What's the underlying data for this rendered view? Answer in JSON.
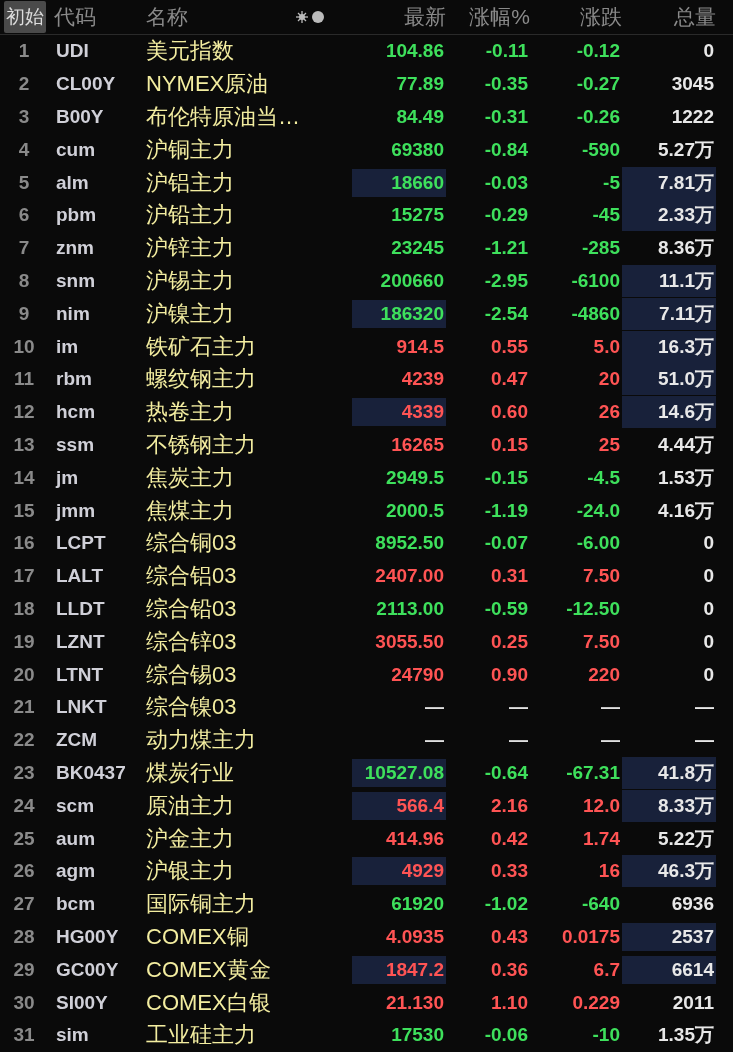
{
  "header": {
    "reset_button": "初始",
    "columns": [
      "代码",
      "名称",
      "最新",
      "涨幅%",
      "涨跌",
      "总量"
    ]
  },
  "rows": [
    {
      "index": "1",
      "code": "UDI",
      "name": "美元指数",
      "price": "104.86",
      "change_pct": "-0.11",
      "change": "-0.12",
      "volume": "0",
      "color": "#3ee05c",
      "price_flash": false,
      "volume_flash": false
    },
    {
      "index": "2",
      "code": "CL00Y",
      "name": "NYMEX原油",
      "price": "77.89",
      "change_pct": "-0.35",
      "change": "-0.27",
      "volume": "3045",
      "color": "#3ee05c",
      "price_flash": false,
      "volume_flash": false
    },
    {
      "index": "3",
      "code": "B00Y",
      "name": "布伦特原油当…",
      "price": "84.49",
      "change_pct": "-0.31",
      "change": "-0.26",
      "volume": "1222",
      "color": "#3ee05c",
      "price_flash": false,
      "volume_flash": false
    },
    {
      "index": "4",
      "code": "cum",
      "name": "沪铜主力",
      "price": "69380",
      "change_pct": "-0.84",
      "change": "-590",
      "volume": "5.27万",
      "color": "#3ee05c",
      "price_flash": false,
      "volume_flash": false
    },
    {
      "index": "5",
      "code": "alm",
      "name": "沪铝主力",
      "price": "18660",
      "change_pct": "-0.03",
      "change": "-5",
      "volume": "7.81万",
      "color": "#3ee05c",
      "price_flash": true,
      "volume_flash": true
    },
    {
      "index": "6",
      "code": "pbm",
      "name": "沪铅主力",
      "price": "15275",
      "change_pct": "-0.29",
      "change": "-45",
      "volume": "2.33万",
      "color": "#3ee05c",
      "price_flash": false,
      "volume_flash": true
    },
    {
      "index": "7",
      "code": "znm",
      "name": "沪锌主力",
      "price": "23245",
      "change_pct": "-1.21",
      "change": "-285",
      "volume": "8.36万",
      "color": "#3ee05c",
      "price_flash": false,
      "volume_flash": false
    },
    {
      "index": "8",
      "code": "snm",
      "name": "沪锡主力",
      "price": "200660",
      "change_pct": "-2.95",
      "change": "-6100",
      "volume": "11.1万",
      "color": "#3ee05c",
      "price_flash": false,
      "volume_flash": true
    },
    {
      "index": "9",
      "code": "nim",
      "name": "沪镍主力",
      "price": "186320",
      "change_pct": "-2.54",
      "change": "-4860",
      "volume": "7.11万",
      "color": "#3ee05c",
      "price_flash": true,
      "volume_flash": true
    },
    {
      "index": "10",
      "code": "im",
      "name": "铁矿石主力",
      "price": "914.5",
      "change_pct": "0.55",
      "change": "5.0",
      "volume": "16.3万",
      "color": "#ff5454",
      "price_flash": false,
      "volume_flash": true
    },
    {
      "index": "11",
      "code": "rbm",
      "name": "螺纹钢主力",
      "price": "4239",
      "change_pct": "0.47",
      "change": "20",
      "volume": "51.0万",
      "color": "#ff5454",
      "price_flash": false,
      "volume_flash": true
    },
    {
      "index": "12",
      "code": "hcm",
      "name": "热卷主力",
      "price": "4339",
      "change_pct": "0.60",
      "change": "26",
      "volume": "14.6万",
      "color": "#ff5454",
      "price_flash": true,
      "volume_flash": true
    },
    {
      "index": "13",
      "code": "ssm",
      "name": "不锈钢主力",
      "price": "16265",
      "change_pct": "0.15",
      "change": "25",
      "volume": "4.44万",
      "color": "#ff5454",
      "price_flash": false,
      "volume_flash": false
    },
    {
      "index": "14",
      "code": "jm",
      "name": "焦炭主力",
      "price": "2949.5",
      "change_pct": "-0.15",
      "change": "-4.5",
      "volume": "1.53万",
      "color": "#3ee05c",
      "price_flash": false,
      "volume_flash": false
    },
    {
      "index": "15",
      "code": "jmm",
      "name": "焦煤主力",
      "price": "2000.5",
      "change_pct": "-1.19",
      "change": "-24.0",
      "volume": "4.16万",
      "color": "#3ee05c",
      "price_flash": false,
      "volume_flash": false
    },
    {
      "index": "16",
      "code": "LCPT",
      "name": "综合铜03",
      "price": "8952.50",
      "change_pct": "-0.07",
      "change": "-6.00",
      "volume": "0",
      "color": "#3ee05c",
      "price_flash": false,
      "volume_flash": false
    },
    {
      "index": "17",
      "code": "LALT",
      "name": "综合铝03",
      "price": "2407.00",
      "change_pct": "0.31",
      "change": "7.50",
      "volume": "0",
      "color": "#ff5454",
      "price_flash": false,
      "volume_flash": false
    },
    {
      "index": "18",
      "code": "LLDT",
      "name": "综合铅03",
      "price": "2113.00",
      "change_pct": "-0.59",
      "change": "-12.50",
      "volume": "0",
      "color": "#3ee05c",
      "price_flash": false,
      "volume_flash": false
    },
    {
      "index": "19",
      "code": "LZNT",
      "name": "综合锌03",
      "price": "3055.50",
      "change_pct": "0.25",
      "change": "7.50",
      "volume": "0",
      "color": "#ff5454",
      "price_flash": false,
      "volume_flash": false
    },
    {
      "index": "20",
      "code": "LTNT",
      "name": "综合锡03",
      "price": "24790",
      "change_pct": "0.90",
      "change": "220",
      "volume": "0",
      "color": "#ff5454",
      "price_flash": false,
      "volume_flash": false
    },
    {
      "index": "21",
      "code": "LNKT",
      "name": "综合镍03",
      "price": "—",
      "change_pct": "—",
      "change": "—",
      "volume": "—",
      "color": "#e0e0e0",
      "price_flash": false,
      "volume_flash": false
    },
    {
      "index": "22",
      "code": "ZCM",
      "name": "动力煤主力",
      "price": "—",
      "change_pct": "—",
      "change": "—",
      "volume": "—",
      "color": "#e0e0e0",
      "price_flash": false,
      "volume_flash": false
    },
    {
      "index": "23",
      "code": "BK0437",
      "name": "煤炭行业",
      "price": "10527.08",
      "change_pct": "-0.64",
      "change": "-67.31",
      "volume": "41.8万",
      "color": "#3ee05c",
      "price_flash": true,
      "volume_flash": true
    },
    {
      "index": "24",
      "code": "scm",
      "name": "原油主力",
      "price": "566.4",
      "change_pct": "2.16",
      "change": "12.0",
      "volume": "8.33万",
      "color": "#ff5454",
      "price_flash": true,
      "volume_flash": true
    },
    {
      "index": "25",
      "code": "aum",
      "name": "沪金主力",
      "price": "414.96",
      "change_pct": "0.42",
      "change": "1.74",
      "volume": "5.22万",
      "color": "#ff5454",
      "price_flash": false,
      "volume_flash": false
    },
    {
      "index": "26",
      "code": "agm",
      "name": "沪银主力",
      "price": "4929",
      "change_pct": "0.33",
      "change": "16",
      "volume": "46.3万",
      "color": "#ff5454",
      "price_flash": true,
      "volume_flash": true
    },
    {
      "index": "27",
      "code": "bcm",
      "name": "国际铜主力",
      "price": "61920",
      "change_pct": "-1.02",
      "change": "-640",
      "volume": "6936",
      "color": "#3ee05c",
      "price_flash": false,
      "volume_flash": false
    },
    {
      "index": "28",
      "code": "HG00Y",
      "name": "COMEX铜",
      "price": "4.0935",
      "change_pct": "0.43",
      "change": "0.0175",
      "volume": "2537",
      "color": "#ff5454",
      "price_flash": false,
      "volume_flash": true
    },
    {
      "index": "29",
      "code": "GC00Y",
      "name": "COMEX黄金",
      "price": "1847.2",
      "change_pct": "0.36",
      "change": "6.7",
      "volume": "6614",
      "color": "#ff5454",
      "price_flash": true,
      "volume_flash": true
    },
    {
      "index": "30",
      "code": "SI00Y",
      "name": "COMEX白银",
      "price": "21.130",
      "change_pct": "1.10",
      "change": "0.229",
      "volume": "2011",
      "color": "#ff5454",
      "price_flash": false,
      "volume_flash": false
    },
    {
      "index": "31",
      "code": "sim",
      "name": "工业硅主力",
      "price": "17530",
      "change_pct": "-0.06",
      "change": "-10",
      "volume": "1.35万",
      "color": "#3ee05c",
      "price_flash": false,
      "volume_flash": false
    }
  ]
}
